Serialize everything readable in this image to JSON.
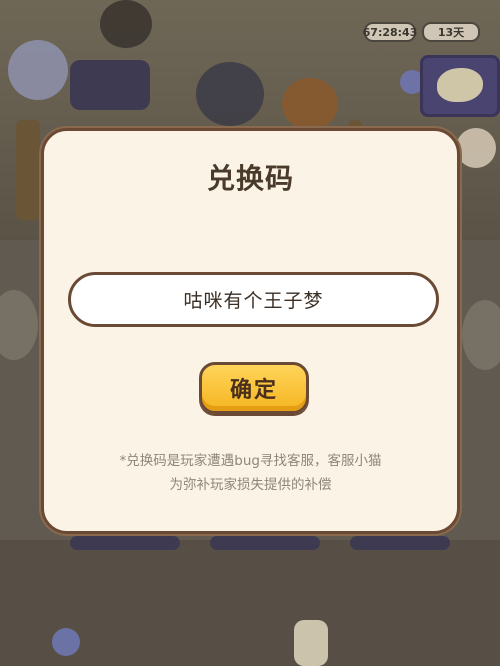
{
  "hud": {
    "timer": "67:28:43",
    "days": "13天"
  },
  "modal": {
    "title": "兑换码",
    "code_value": "咕咪有个王子梦",
    "confirm_label": "确定",
    "note_line1": "*兑换码是玩家遭遇bug寻找客服，客服小猫",
    "note_line2": "为弥补玩家损失提供的补偿"
  },
  "colors": {
    "modal_bg": "#fbf4e6",
    "modal_border": "#6b4a35",
    "button_fill": "#f5b521",
    "note_text": "#8f8678"
  }
}
